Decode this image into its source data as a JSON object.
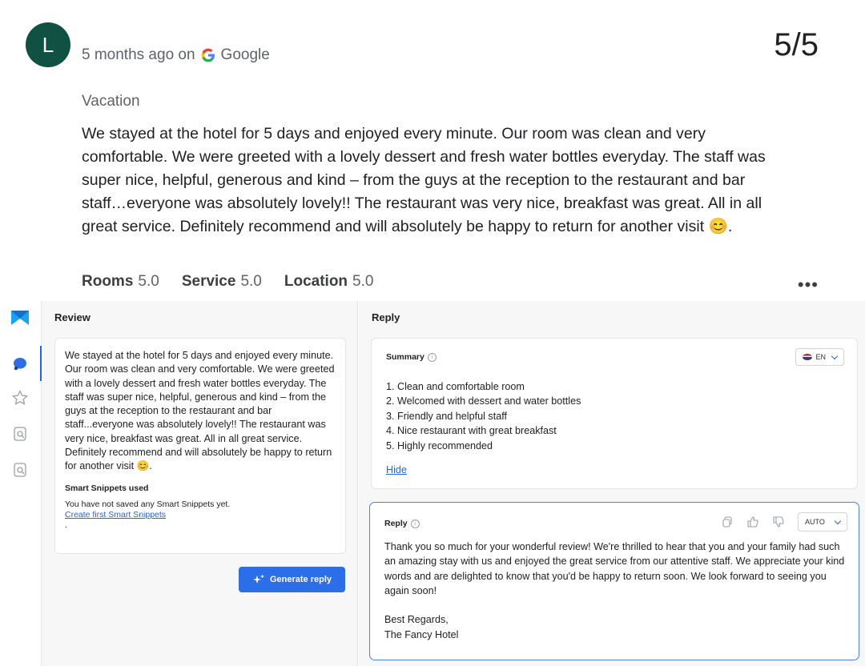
{
  "review_header": {
    "avatar_letter": "L",
    "time_text": "5 months ago on",
    "source": "Google",
    "score": "5/5",
    "title": "Vacation",
    "text": "We stayed at the hotel for 5 days and enjoyed every minute. Our room was clean and very comfortable. We were greeted with a lovely dessert and fresh water bottles everyday. The staff was super nice, helpful, generous and kind – from the guys at the reception to the restaurant and bar staff…everyone was absolutely lovely!! The restaurant was very nice, breakfast was great. All in all great service. Definitely recommend and will absolutely be happy to return for another visit 😊.",
    "ratings": [
      {
        "label": "Rooms",
        "value": "5.0"
      },
      {
        "label": "Service",
        "value": "5.0"
      },
      {
        "label": "Location",
        "value": "5.0"
      }
    ],
    "more_menu": "•••"
  },
  "sidebar": {
    "items": [
      {
        "icon": "logo-icon"
      },
      {
        "icon": "chat-bubble-icon",
        "active": true
      },
      {
        "icon": "star-icon"
      },
      {
        "icon": "doc-search-icon"
      },
      {
        "icon": "doc-search-icon"
      }
    ]
  },
  "review_panel": {
    "title": "Review",
    "text": "We stayed at the hotel for 5 days and enjoyed every minute. Our room was clean and very comfortable. We were greeted with a lovely dessert and fresh water bottles everyday. The staff was super nice, helpful, generous and kind – from the guys at the reception to the restaurant and bar staff...everyone was absolutely lovely!! The restaurant was very nice, breakfast was great. All in all great service. Definitely recommend and will absolutely be happy to return for another visit 😊.",
    "snippets_title": "Smart Snippets used",
    "snippets_empty": "You have not saved any Smart Snippets yet.",
    "snippets_link": "Create first Smart Snippets",
    "snippets_dot": ".",
    "generate_button": "Generate reply"
  },
  "reply_panel": {
    "title": "Reply",
    "summary": {
      "heading": "Summary",
      "language": "EN",
      "items": [
        "1. Clean and comfortable room",
        "2. Welcomed with dessert and water bottles",
        "3. Friendly and helpful staff",
        "4. Nice restaurant with great breakfast",
        "5. Highly recommended"
      ],
      "hide_link": "Hide"
    },
    "reply": {
      "heading": "Reply",
      "mode": "AUTO",
      "text": "Thank you so much for your wonderful review! We're thrilled to hear that you and your family had such an amazing stay with us and enjoyed the great service from our attentive staff. We appreciate your kind words and are delighted to know that you'd be happy to return soon. We look forward to seeing you again soon!\n\nBest Regards,\nThe Fancy Hotel"
    }
  },
  "colors": {
    "avatar": "#0f5243",
    "accent": "#2c6ee8",
    "link": "#2563eb",
    "reply_border": "#4a7ff0"
  }
}
